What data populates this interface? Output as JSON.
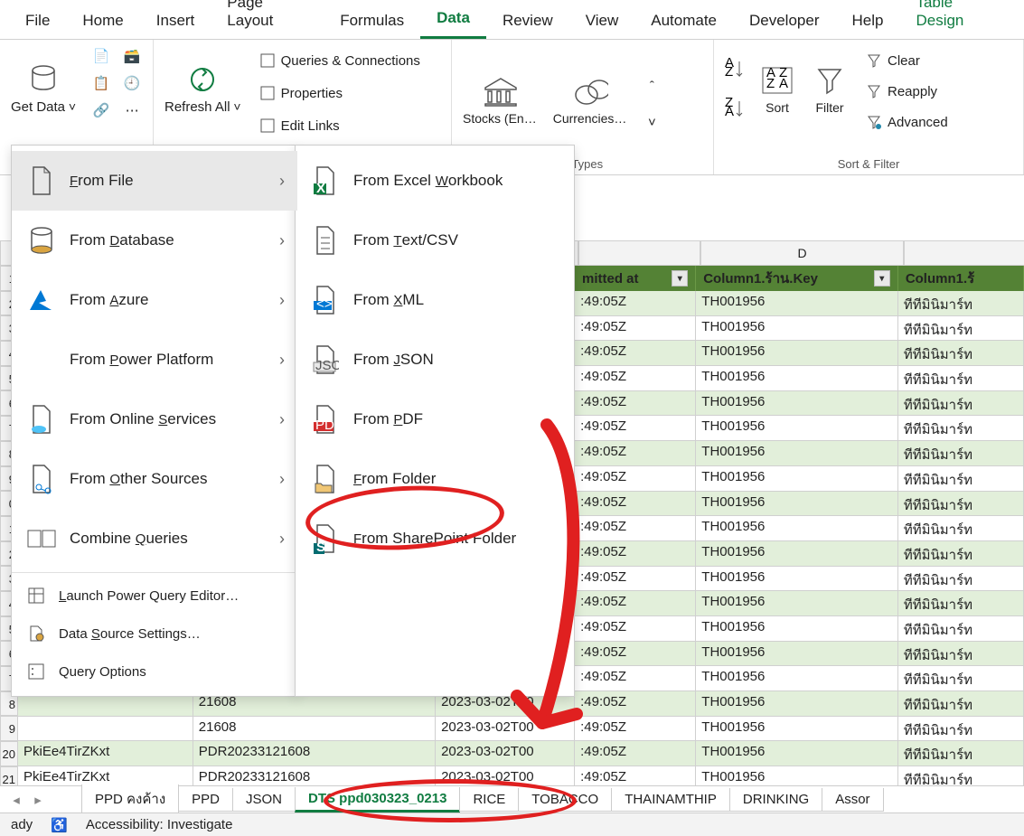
{
  "tabs": [
    "File",
    "Home",
    "Insert",
    "Page Layout",
    "Formulas",
    "Data",
    "Review",
    "View",
    "Automate",
    "Developer",
    "Help",
    "Table Design"
  ],
  "active_tab": "Data",
  "ribbon": {
    "getdata": {
      "label": "Get\nData"
    },
    "refresh": {
      "label": "Refresh\nAll"
    },
    "qc": {
      "a": "Queries & Connections",
      "b": "Properties",
      "c": "Edit Links"
    },
    "stocks": "Stocks (En…",
    "curr": "Currencies…",
    "datatypes_cap": "a Types",
    "sort": "Sort",
    "filter": "Filter",
    "clear": "Clear",
    "reapply": "Reapply",
    "advanced": "Advanced",
    "sf_cap": "Sort & Filter"
  },
  "menu1": [
    {
      "id": "from-file",
      "label": "From File",
      "hl": true
    },
    {
      "id": "from-db",
      "label": "From Database"
    },
    {
      "id": "from-azure",
      "label": "From Azure"
    },
    {
      "id": "from-pp",
      "label": "From Power Platform"
    },
    {
      "id": "from-online",
      "label": "From Online Services"
    },
    {
      "id": "from-other",
      "label": "From Other Sources"
    },
    {
      "id": "combine-q",
      "label": "Combine Queries"
    }
  ],
  "menu1_bottom": [
    {
      "id": "launch-pq",
      "label": "Launch Power Query Editor…"
    },
    {
      "id": "ds-settings",
      "label": "Data Source Settings…"
    },
    {
      "id": "query-opts",
      "label": "Query Options"
    }
  ],
  "menu2": [
    {
      "id": "from-xlwb",
      "label": "From Excel Workbook"
    },
    {
      "id": "from-csv",
      "label": "From Text/CSV"
    },
    {
      "id": "from-xml",
      "label": "From XML"
    },
    {
      "id": "from-json",
      "label": "From JSON"
    },
    {
      "id": "from-pdf",
      "label": "From PDF"
    },
    {
      "id": "from-folder",
      "label": "From Folder"
    },
    {
      "id": "from-sp",
      "label": "From SharePoint Folder"
    }
  ],
  "colheads": {
    "d": "D"
  },
  "table_headers": {
    "c": "mitted at",
    "d": "Column1.ร้าน.Key",
    "e": "Column1.ร้"
  },
  "row_labels": [
    1,
    2,
    3,
    4,
    5,
    6,
    7,
    8,
    9,
    0,
    1,
    2,
    3,
    4,
    5,
    6,
    7,
    8,
    9,
    "20",
    "21"
  ],
  "data": {
    "ts": ":49:05Z",
    "full_ts": "2023-03-02T00:49:05Z",
    "partial_ts_a": "21608",
    "partial_ts_b": "2023-03-02T00:49:05Z",
    "key": "TH001956",
    "shop": "ทีทีมินิมาร์ท",
    "id_a": "PkiEe4TirZKxt",
    "id_b": "PDR20233121608"
  },
  "sheets": [
    "PPD คงค้าง",
    "PPD",
    "JSON",
    "DTS ppd030323_0213",
    "RICE",
    "TOBACCO",
    "THAINAMTHIP",
    "DRINKING",
    "Assor"
  ],
  "active_sheet": "DTS ppd030323_0213",
  "status": {
    "ready": "ady",
    "acc": "Accessibility: Investigate"
  }
}
